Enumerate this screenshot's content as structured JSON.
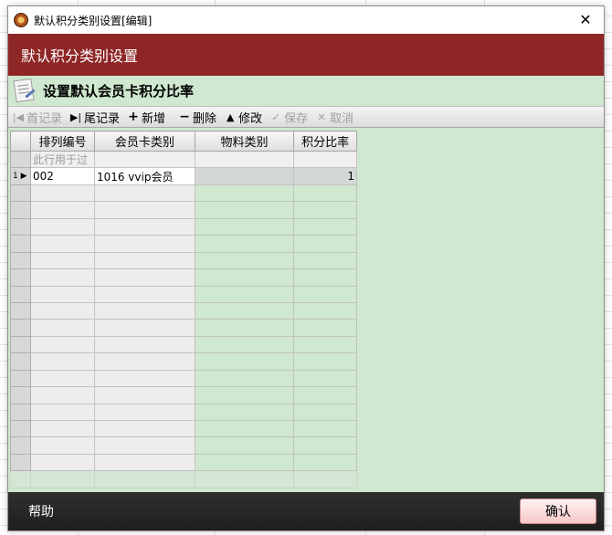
{
  "window": {
    "title": "默认积分类别设置[编辑]",
    "close_glyph": "✕"
  },
  "header": {
    "title": "默认积分类别设置"
  },
  "section": {
    "title": "设置默认会员卡积分比率"
  },
  "toolbar": {
    "first_label": "首记录",
    "last_label": "尾记录",
    "add_label": "新增",
    "delete_label": "删除",
    "edit_label": "修改",
    "save_label": "保存",
    "cancel_label": "取消"
  },
  "grid": {
    "columns": [
      "排列编号",
      "会员卡类别",
      "物料类别",
      "积分比率"
    ],
    "filter_placeholder": "此行用于过",
    "rows": [
      {
        "index": "1",
        "code": "002",
        "card_type": "1016 vvip会员",
        "material": "",
        "ratio": "1"
      }
    ]
  },
  "footer": {
    "help_label": "帮助",
    "ok_label": "确认"
  },
  "colors": {
    "header_band": "#8f2626",
    "content_bg": "#cfe8cf",
    "bottom_bar": "#262626"
  }
}
